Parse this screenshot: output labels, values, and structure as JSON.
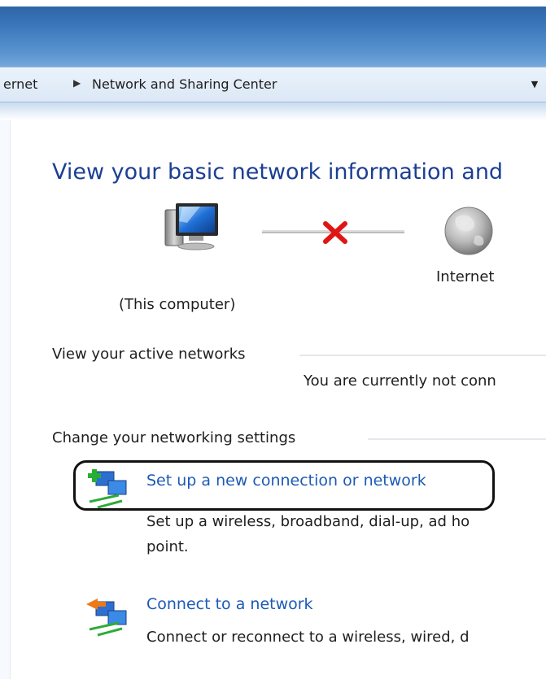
{
  "address_bar": {
    "crumb_prev": "ernet",
    "crumb_current": "Network and Sharing Center",
    "separator_icon": "chevron-right-icon",
    "dropdown_icon": "chevron-down-icon"
  },
  "heading": "View your basic network information and",
  "network_map": {
    "computer_label": "(This computer)",
    "internet_label": "Internet",
    "status": "disconnected",
    "status_icon": "red-x-icon"
  },
  "active_networks": {
    "title": "View your active networks",
    "status_text": "You are currently not conn"
  },
  "settings": {
    "title": "Change your networking settings",
    "items": [
      {
        "icon": "new-connection-icon",
        "link": "Set up a new connection or network",
        "desc_line1": "Set up a wireless, broadband, dial-up, ad ho",
        "desc_line2": "point."
      },
      {
        "icon": "connect-network-icon",
        "link": "Connect to a network",
        "desc_line1": "Connect or reconnect to a wireless, wired, d"
      }
    ]
  },
  "colors": {
    "link": "#1c5ab5",
    "heading": "#1c3f94",
    "error_x": "#e01515"
  }
}
